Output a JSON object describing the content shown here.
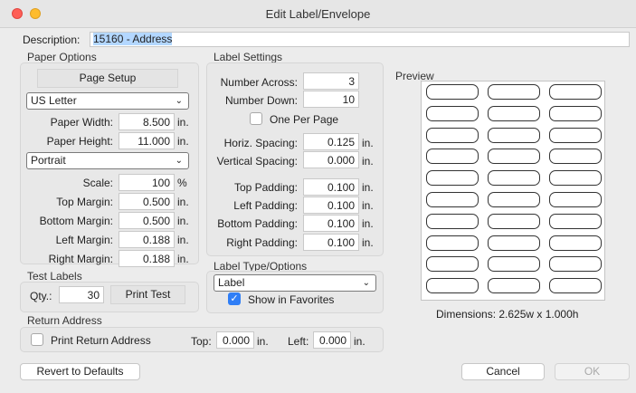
{
  "window": {
    "title": "Edit Label/Envelope"
  },
  "description": {
    "label": "Description:",
    "value": "15160 - Address"
  },
  "paper_options": {
    "heading": "Paper Options",
    "page_setup_label": "Page Setup",
    "paper_size": "US Letter",
    "paper_width": {
      "label": "Paper Width:",
      "value": "8.500",
      "unit": "in."
    },
    "paper_height": {
      "label": "Paper Height:",
      "value": "11.000",
      "unit": "in."
    },
    "orientation": "Portrait",
    "scale": {
      "label": "Scale:",
      "value": "100",
      "unit": "%"
    },
    "top_margin": {
      "label": "Top Margin:",
      "value": "0.500",
      "unit": "in."
    },
    "bottom_margin": {
      "label": "Bottom Margin:",
      "value": "0.500",
      "unit": "in."
    },
    "left_margin": {
      "label": "Left Margin:",
      "value": "0.188",
      "unit": "in."
    },
    "right_margin": {
      "label": "Right Margin:",
      "value": "0.188",
      "unit": "in."
    }
  },
  "label_settings": {
    "heading": "Label Settings",
    "number_across": {
      "label": "Number Across:",
      "value": "3"
    },
    "number_down": {
      "label": "Number Down:",
      "value": "10"
    },
    "one_per_page": {
      "label": "One Per Page",
      "checked": false
    },
    "horiz_spacing": {
      "label": "Horiz. Spacing:",
      "value": "0.125",
      "unit": "in."
    },
    "vertical_spacing": {
      "label": "Vertical Spacing:",
      "value": "0.000",
      "unit": "in."
    },
    "top_padding": {
      "label": "Top Padding:",
      "value": "0.100",
      "unit": "in."
    },
    "left_padding": {
      "label": "Left Padding:",
      "value": "0.100",
      "unit": "in."
    },
    "bottom_padding": {
      "label": "Bottom Padding:",
      "value": "0.100",
      "unit": "in."
    },
    "right_padding": {
      "label": "Right Padding:",
      "value": "0.100",
      "unit": "in."
    }
  },
  "label_type": {
    "heading": "Label Type/Options",
    "type": "Label",
    "show_in_favorites": {
      "label": "Show in Favorites",
      "checked": true
    }
  },
  "preview": {
    "heading": "Preview",
    "columns": 3,
    "rows": 10,
    "dimensions": "Dimensions: 2.625w x 1.000h"
  },
  "test_labels": {
    "heading": "Test Labels",
    "qty_label": "Qty.:",
    "qty_value": "30",
    "print_test_label": "Print Test"
  },
  "return_address": {
    "heading": "Return Address",
    "print_label": "Print Return Address",
    "print_checked": false,
    "top_label": "Top:",
    "top_value": "0.000",
    "left_label": "Left:",
    "left_value": "0.000",
    "unit": "in."
  },
  "footer": {
    "revert_label": "Revert to Defaults",
    "cancel_label": "Cancel",
    "ok_label": "OK"
  },
  "colors": {
    "accent": "#2f7ef6",
    "close": "#fe5f57",
    "minimize": "#febc2e"
  }
}
